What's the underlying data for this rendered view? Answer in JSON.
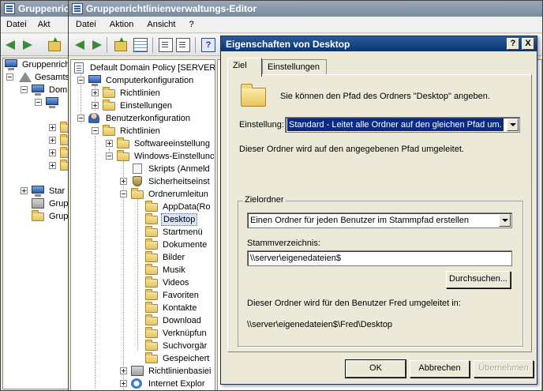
{
  "win1": {
    "title": "Gruppenrich",
    "menu": [
      "Datei",
      "Akt"
    ]
  },
  "tree1": [
    {
      "label": "Gruppenrich"
    },
    {
      "label": "Gesamts"
    },
    {
      "label": "Dom"
    },
    {
      "label": "Star"
    },
    {
      "label": "Grup"
    },
    {
      "label": "Grup"
    }
  ],
  "gpme": {
    "title": "Gruppenrichtlinienverwaltungs-Editor",
    "menu": [
      "Datei",
      "Aktion",
      "Ansicht",
      "?"
    ]
  },
  "tree2": [
    {
      "label": "Default Domain Policy [SERVER."
    },
    {
      "label": "Computerkonfiguration"
    },
    {
      "label": "Richtlinien"
    },
    {
      "label": "Einstellungen"
    },
    {
      "label": "Benutzerkonfiguration"
    },
    {
      "label": "Richtlinien"
    },
    {
      "label": "Softwareeinstellung"
    },
    {
      "label": "Windows-Einstellunc"
    },
    {
      "label": "Skripts (Anmeld"
    },
    {
      "label": "Sicherheitseinst"
    },
    {
      "label": "Ordnerumleitun"
    },
    {
      "label": "AppData(Ro"
    },
    {
      "label": "Desktop"
    },
    {
      "label": "Startmenü"
    },
    {
      "label": "Dokumente"
    },
    {
      "label": "Bilder"
    },
    {
      "label": "Musik"
    },
    {
      "label": "Videos"
    },
    {
      "label": "Favoriten"
    },
    {
      "label": "Kontakte"
    },
    {
      "label": "Download"
    },
    {
      "label": "Verknüpfun"
    },
    {
      "label": "Suchvorgär"
    },
    {
      "label": "Gespeichert"
    },
    {
      "label": "Richtlinienbasiei"
    },
    {
      "label": "Internet Explor"
    }
  ],
  "dialog": {
    "title": "Eigenschaften von Desktop",
    "help_btn": "?",
    "close_btn": "X",
    "tabs": [
      "Ziel",
      "Einstellungen"
    ],
    "info": "Sie können den Pfad des Ordners \"Desktop\" angeben.",
    "setting_label": "Einstellung:",
    "setting_value": "Standard - Leitet alle Ordner auf den gleichen Pfad um.",
    "setting_desc": "Dieser Ordner wird auf den angegebenen Pfad umgeleitet.",
    "group_label": "Zielordner",
    "target_value": "Einen Ordner für jeden Benutzer im Stammpfad erstellen",
    "root_label": "Stammverzeichnis:",
    "root_value": "\\\\server\\eigenedateien$",
    "browse": "Durchsuchen...",
    "redirect_note": "Dieser Ordner wird für den Benutzer Fred umgeleitet in:",
    "redirect_path": "\\\\server\\eigenedateien$\\Fred\\Desktop",
    "ok": "OK",
    "cancel": "Abbrechen",
    "apply": "Übernehmen"
  }
}
